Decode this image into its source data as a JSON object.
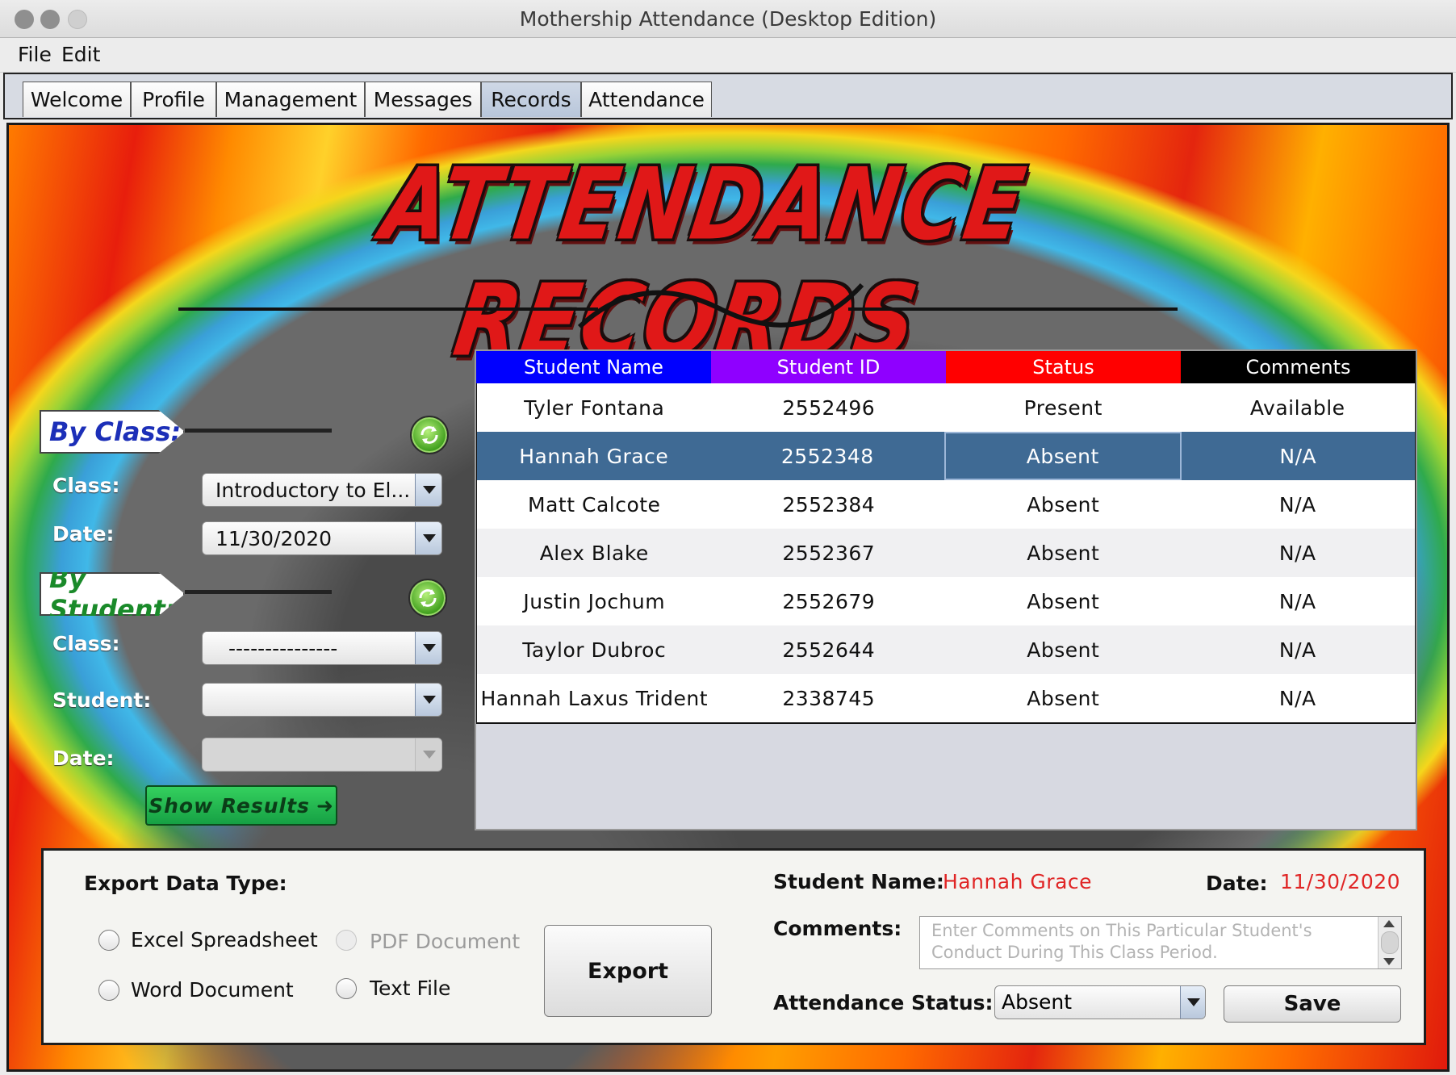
{
  "window": {
    "title": "Mothership Attendance (Desktop Edition)"
  },
  "menu": [
    "File",
    "Edit"
  ],
  "tabs": [
    "Welcome",
    "Profile",
    "Management",
    "Messages",
    "Records",
    "Attendance"
  ],
  "active_tab": "Records",
  "hero": {
    "title": "ATTENDANCE RECORDS"
  },
  "by_class": {
    "badge": "By Class:",
    "class_label": "Class:",
    "class_value": "Introductory to El...",
    "date_label": "Date:",
    "date_value": "11/30/2020"
  },
  "by_student": {
    "badge": "By Student:",
    "class_label": "Class:",
    "class_value": "---------------",
    "student_label": "Student:",
    "student_value": "",
    "date_label": "Date:",
    "date_value": ""
  },
  "show_results": "Show Results",
  "table": {
    "columns": [
      {
        "label": "Student Name",
        "color": "#0000ff"
      },
      {
        "label": "Student ID",
        "color": "#8f00ff"
      },
      {
        "label": "Status",
        "color": "#ff0000"
      },
      {
        "label": "Comments",
        "color": "#000000"
      }
    ],
    "rows": [
      [
        "Tyler Fontana",
        "2552496",
        "Present",
        "Available"
      ],
      [
        "Hannah Grace",
        "2552348",
        "Absent",
        "N/A"
      ],
      [
        "Matt Calcote",
        "2552384",
        "Absent",
        "N/A"
      ],
      [
        "Alex Blake",
        "2552367",
        "Absent",
        "N/A"
      ],
      [
        "Justin Jochum",
        "2552679",
        "Absent",
        "N/A"
      ],
      [
        "Taylor Dubroc",
        "2552644",
        "Absent",
        "N/A"
      ],
      [
        "Hannah Laxus Trident",
        "2338745",
        "Absent",
        "N/A"
      ]
    ],
    "selected_row": 1
  },
  "export": {
    "label": "Export Data Type:",
    "options": [
      "Excel Spreadsheet",
      "PDF Document",
      "Word Document",
      "Text File"
    ],
    "button": "Export"
  },
  "detail": {
    "student_name_label": "Student Name:",
    "student_name": "Hannah Grace",
    "date_label": "Date:",
    "date": "11/30/2020",
    "comments_label": "Comments:",
    "comments_placeholder": "Enter Comments on This Particular Student's Conduct During This Class Period.",
    "status_label": "Attendance Status:",
    "status_value": "Absent",
    "save_button": "Save"
  }
}
